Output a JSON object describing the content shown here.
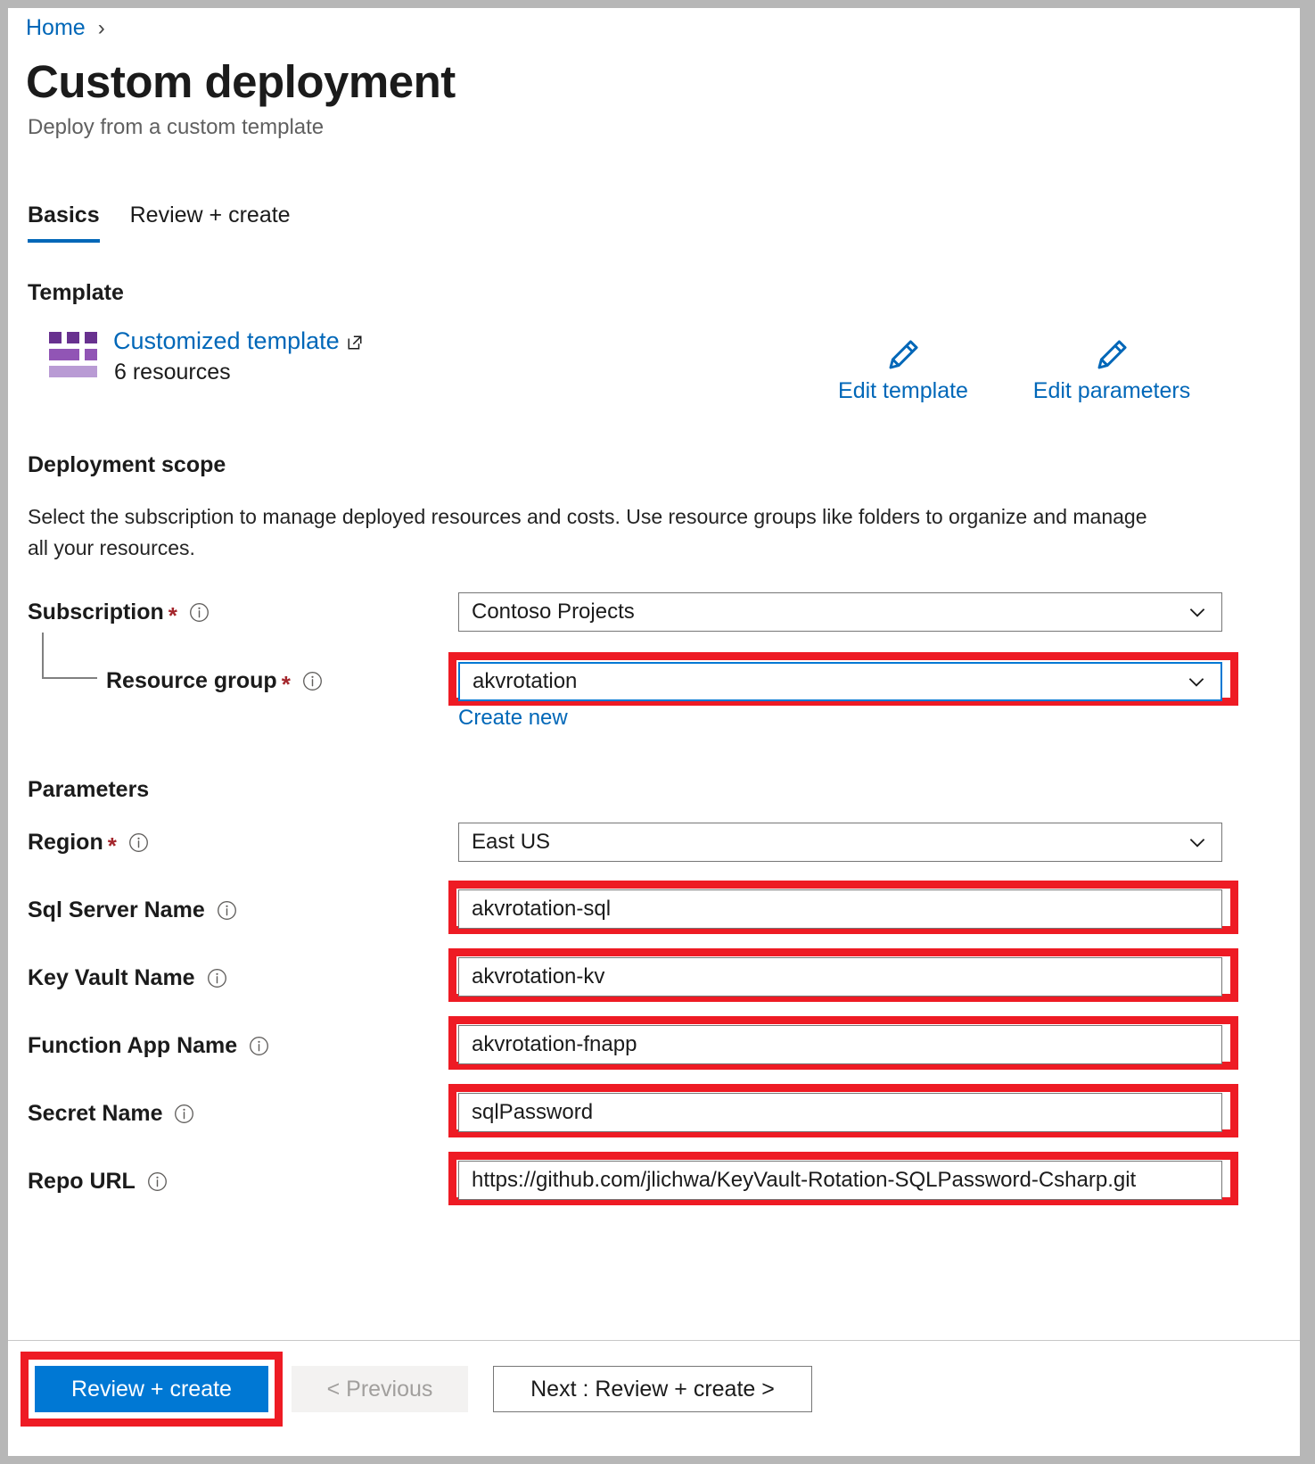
{
  "breadcrumb": {
    "home": "Home",
    "separator": "›"
  },
  "header": {
    "title": "Custom deployment",
    "subtitle": "Deploy from a custom template"
  },
  "tabs": [
    {
      "label": "Basics",
      "active": true
    },
    {
      "label": "Review + create",
      "active": false
    }
  ],
  "template_section": {
    "heading": "Template",
    "link_label": "Customized template",
    "link_icon": "external-link-icon",
    "resources_count": "6 resources",
    "template_icon": "template-grid-icon",
    "actions": [
      {
        "label": "Edit template",
        "icon": "pencil-icon"
      },
      {
        "label": "Edit parameters",
        "icon": "pencil-icon"
      }
    ]
  },
  "deployment_scope": {
    "heading": "Deployment scope",
    "description": "Select the subscription to manage deployed resources and costs. Use resource groups like folders to organize and manage all your resources.",
    "subscription": {
      "label": "Subscription",
      "required": "*",
      "info_icon": "info-icon",
      "value": "Contoso Projects",
      "chevron": "chevron-down-icon"
    },
    "resource_group": {
      "label": "Resource group",
      "required": "*",
      "info_icon": "info-icon",
      "value": "akvrotation",
      "chevron": "chevron-down-icon",
      "create_new": "Create new",
      "highlighted": true,
      "focused": true
    }
  },
  "parameters": {
    "heading": "Parameters",
    "fields": [
      {
        "label": "Region",
        "required": "*",
        "info_icon": "info-icon",
        "value": "East US",
        "type": "dropdown",
        "highlighted": false
      },
      {
        "label": "Sql Server Name",
        "required": "",
        "info_icon": "info-icon",
        "value": "akvrotation-sql",
        "type": "text",
        "highlighted": true
      },
      {
        "label": "Key Vault Name",
        "required": "",
        "info_icon": "info-icon",
        "value": "akvrotation-kv",
        "type": "text",
        "highlighted": true
      },
      {
        "label": "Function App Name",
        "required": "",
        "info_icon": "info-icon",
        "value": "akvrotation-fnapp",
        "type": "text",
        "highlighted": true
      },
      {
        "label": "Secret Name",
        "required": "",
        "info_icon": "info-icon",
        "value": "sqlPassword",
        "type": "text",
        "highlighted": true
      },
      {
        "label": "Repo URL",
        "required": "",
        "info_icon": "info-icon",
        "value": "https://github.com/jlichwa/KeyVault-Rotation-SQLPassword-Csharp.git",
        "type": "text",
        "highlighted": true
      }
    ]
  },
  "footer": {
    "review_create": "Review + create",
    "previous": "< Previous",
    "next": "Next : Review + create >",
    "review_create_highlighted": true
  },
  "colors": {
    "accent_blue": "#0078d4",
    "link_blue": "#0067b8",
    "annotation_red": "#ee1b24",
    "required_red": "#a4262c",
    "template_purple": "#8661c5",
    "page_bg": "#b7b7b7"
  }
}
